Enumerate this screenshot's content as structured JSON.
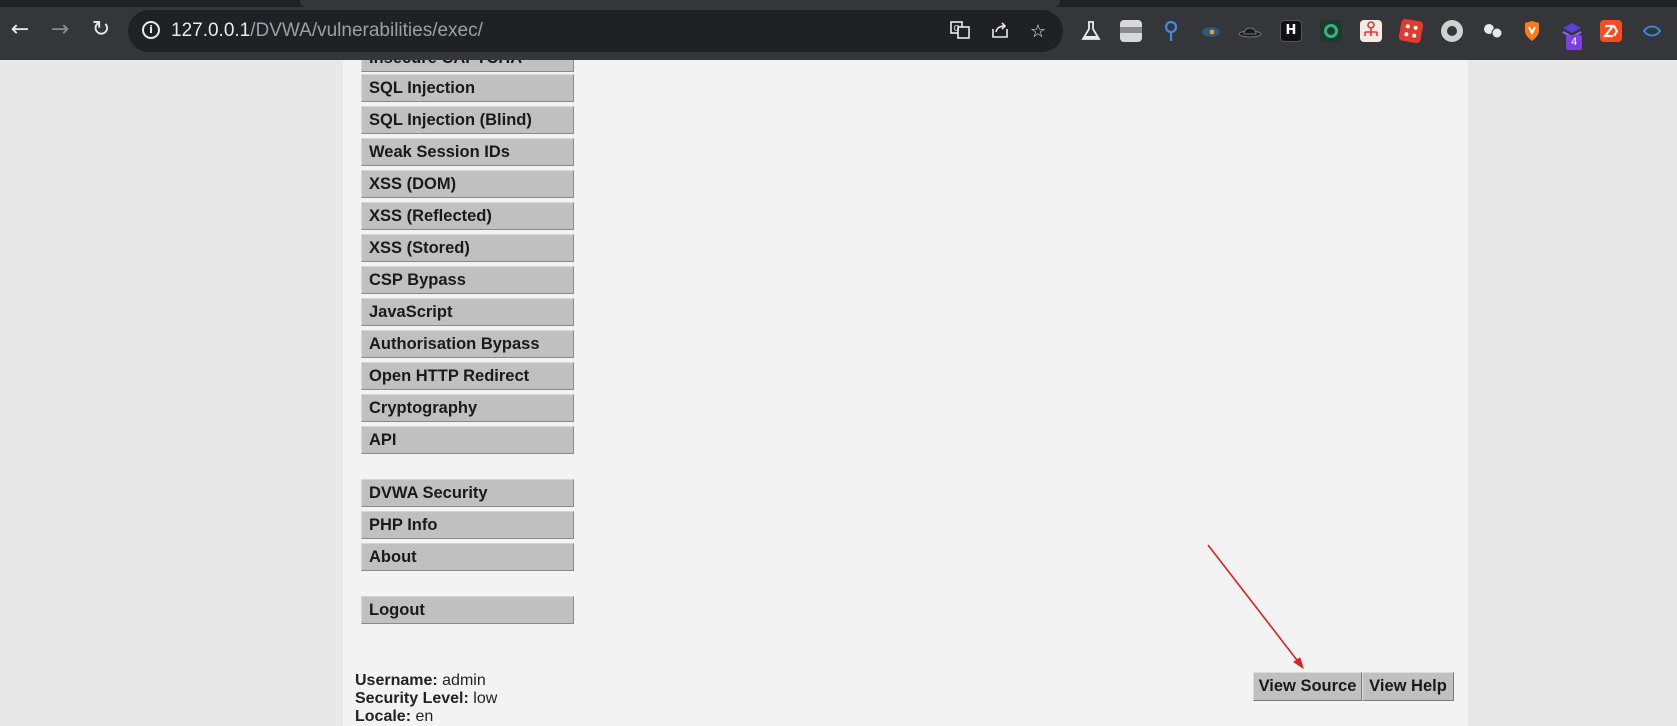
{
  "browser": {
    "url_host": "127.0.0.1",
    "url_path": "/DVWA/vulnerabilities/exec/",
    "icons": [
      "back-icon",
      "forward-icon",
      "reload-icon",
      "site-info-icon",
      "translate-icon",
      "share-icon",
      "bookmark-star-icon"
    ],
    "extensions_badge": "4"
  },
  "menu": {
    "items": [
      {
        "label": "Insecure CAPTCHA"
      },
      {
        "label": "SQL Injection"
      },
      {
        "label": "SQL Injection (Blind)"
      },
      {
        "label": "Weak Session IDs"
      },
      {
        "label": "XSS (DOM)"
      },
      {
        "label": "XSS (Reflected)"
      },
      {
        "label": "XSS (Stored)"
      },
      {
        "label": "CSP Bypass"
      },
      {
        "label": "JavaScript"
      },
      {
        "label": "Authorisation Bypass"
      },
      {
        "label": "Open HTTP Redirect"
      },
      {
        "label": "Cryptography"
      },
      {
        "label": "API"
      }
    ],
    "admin_items": [
      {
        "label": "DVWA Security"
      },
      {
        "label": "PHP Info"
      },
      {
        "label": "About"
      }
    ],
    "logout": {
      "label": "Logout"
    }
  },
  "footer": {
    "username_label": "Username:",
    "username_value": "admin",
    "security_label": "Security Level:",
    "security_value": "low",
    "locale_label": "Locale:",
    "locale_value": "en"
  },
  "buttons": {
    "view_source": "View Source",
    "view_help": "View Help"
  },
  "annotation": {
    "arrow_color": "#e02020"
  }
}
